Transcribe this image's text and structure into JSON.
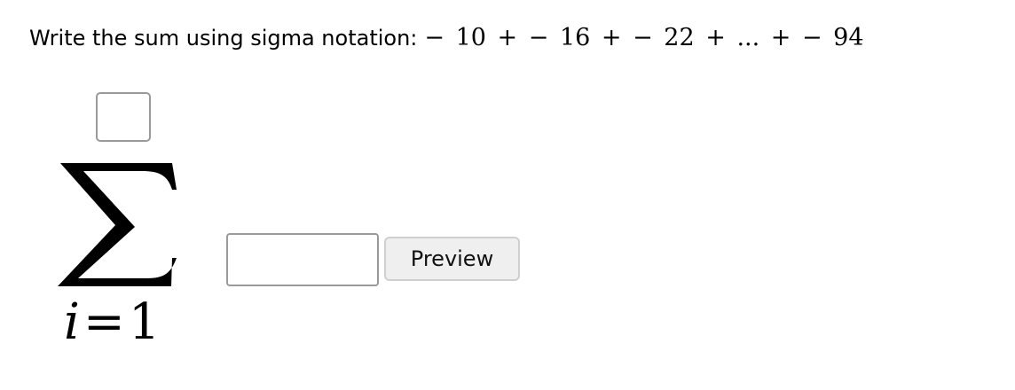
{
  "question": {
    "prompt": "Write the sum using sigma notation:",
    "expression": "− 10 + − 16 + − 22 + ... + − 94"
  },
  "sigma": {
    "symbol": "Σ",
    "index_variable": "i",
    "equals": "=",
    "lower_limit": "1",
    "upper_limit_value": ""
  },
  "summand": {
    "value": ""
  },
  "preview_button": {
    "label": "Preview"
  }
}
